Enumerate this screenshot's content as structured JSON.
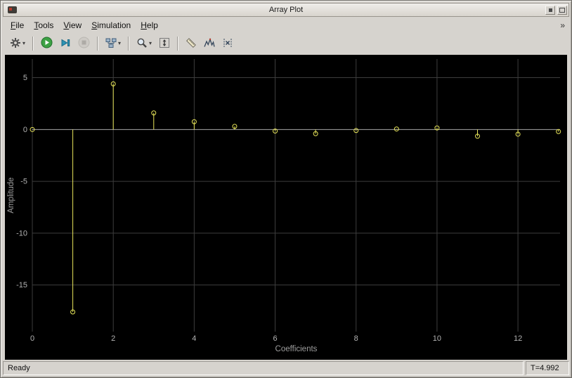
{
  "window": {
    "title": "Array Plot"
  },
  "menu": {
    "items": [
      {
        "label": "File",
        "underline": 0
      },
      {
        "label": "Tools",
        "underline": 0
      },
      {
        "label": "View",
        "underline": 0
      },
      {
        "label": "Simulation",
        "underline": 0
      },
      {
        "label": "Help",
        "underline": 0
      }
    ],
    "overflow_glyph": "»"
  },
  "toolbar": {
    "buttons": [
      {
        "name": "settings",
        "icon": "gear-icon",
        "dropdown": true
      },
      {
        "name": "run",
        "icon": "play-icon"
      },
      {
        "name": "step-forward",
        "icon": "step-forward-icon"
      },
      {
        "name": "stop",
        "icon": "stop-icon",
        "disabled": true
      },
      {
        "name": "layout",
        "icon": "blocks-icon",
        "dropdown": true
      },
      {
        "name": "zoom",
        "icon": "magnifier-icon",
        "dropdown": true
      },
      {
        "name": "fit-to-view",
        "icon": "fit-arrows-icon"
      },
      {
        "name": "measurements",
        "icon": "ruler-icon"
      },
      {
        "name": "peak-finder",
        "icon": "peaks-icon"
      },
      {
        "name": "cursor-measurements",
        "icon": "cursor-x-icon"
      }
    ]
  },
  "status": {
    "message": "Ready",
    "time": "T=4.992"
  },
  "chart_data": {
    "type": "stem",
    "title": "",
    "xlabel": "Coefficients",
    "ylabel": "Amplitude",
    "x": [
      0,
      1,
      2,
      3,
      4,
      5,
      6,
      7,
      8,
      9,
      10,
      11,
      12,
      13
    ],
    "values": [
      0,
      -17.6,
      4.4,
      1.6,
      0.75,
      0.3,
      -0.15,
      -0.4,
      -0.1,
      0.05,
      0.15,
      -0.65,
      -0.45,
      -0.2
    ],
    "xlim": [
      0,
      13.04
    ],
    "ylim": [
      -19.5,
      6.8
    ],
    "xticks": [
      0,
      2,
      4,
      6,
      8,
      10,
      12
    ],
    "yticks": [
      5,
      0,
      -5,
      -10,
      -15
    ],
    "grid": true,
    "legend": false,
    "colors": {
      "background": "#000000",
      "grid": "#3d3d3d",
      "zero_line": "#a6a6a6",
      "stem": "#e8e55a",
      "tick_text": "#b3b3b3",
      "axis_label": "#9e9e9e"
    }
  }
}
